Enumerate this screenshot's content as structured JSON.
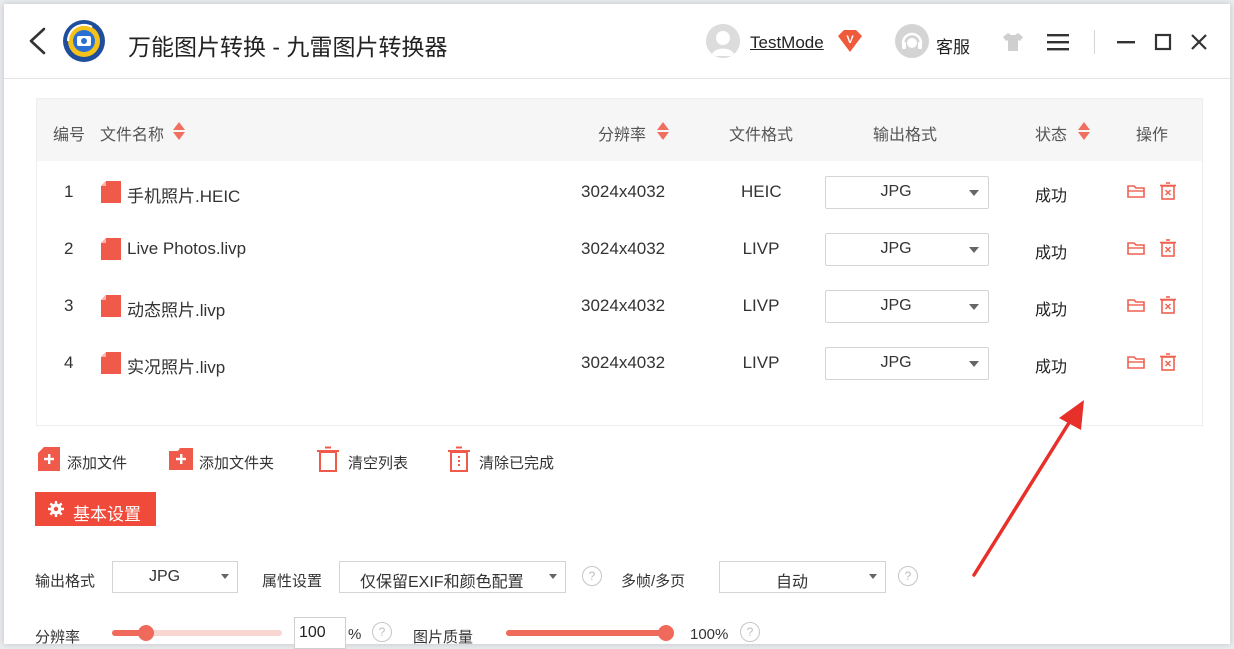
{
  "titlebar": {
    "app_title": "万能图片转换 - 九雷图片转换器",
    "user_name": "TestMode",
    "vip_badge": "V",
    "service_label": "客服",
    "icons": [
      "back-icon",
      "app-logo",
      "user-avatar",
      "vip-badge-icon",
      "service-avatar",
      "skin-icon",
      "menu-icon",
      "minimize-icon",
      "maximize-icon",
      "close-icon"
    ]
  },
  "table": {
    "headers": {
      "index": "编号",
      "name": "文件名称",
      "resolution": "分辨率",
      "format": "文件格式",
      "output": "输出格式",
      "status": "状态",
      "ops": "操作"
    },
    "rows": [
      {
        "index": "1",
        "name": "手机照片.HEIC",
        "resolution": "3024x4032",
        "format": "HEIC",
        "output": "JPG",
        "status": "成功"
      },
      {
        "index": "2",
        "name": "Live Photos.livp",
        "resolution": "3024x4032",
        "format": "LIVP",
        "output": "JPG",
        "status": "成功"
      },
      {
        "index": "3",
        "name": "动态照片.livp",
        "resolution": "3024x4032",
        "format": "LIVP",
        "output": "JPG",
        "status": "成功"
      },
      {
        "index": "4",
        "name": "实况照片.livp",
        "resolution": "3024x4032",
        "format": "LIVP",
        "output": "JPG",
        "status": "成功"
      }
    ]
  },
  "actions": {
    "add_file": "添加文件",
    "add_folder": "添加文件夹",
    "clear_list": "清空列表",
    "clear_done": "清除已完成"
  },
  "settings": {
    "basic_label": "基本设置",
    "output_format_label": "输出格式",
    "output_format_value": "JPG",
    "attr_label": "属性设置",
    "attr_value": "仅保留EXIF和颜色配置",
    "multiframe_label": "多帧/多页",
    "multiframe_value": "自动",
    "resolution_label": "分辨率",
    "resolution_value": "100",
    "resolution_unit": "%",
    "resolution_slider_fraction": 0.2,
    "quality_label": "图片质量",
    "quality_value": "100%",
    "quality_slider_fraction": 1.0,
    "help_glyph": "?"
  },
  "colors": {
    "accent": "#ef4a3a",
    "file_icon": "#f05a4a",
    "arrow": "#e8302a"
  }
}
